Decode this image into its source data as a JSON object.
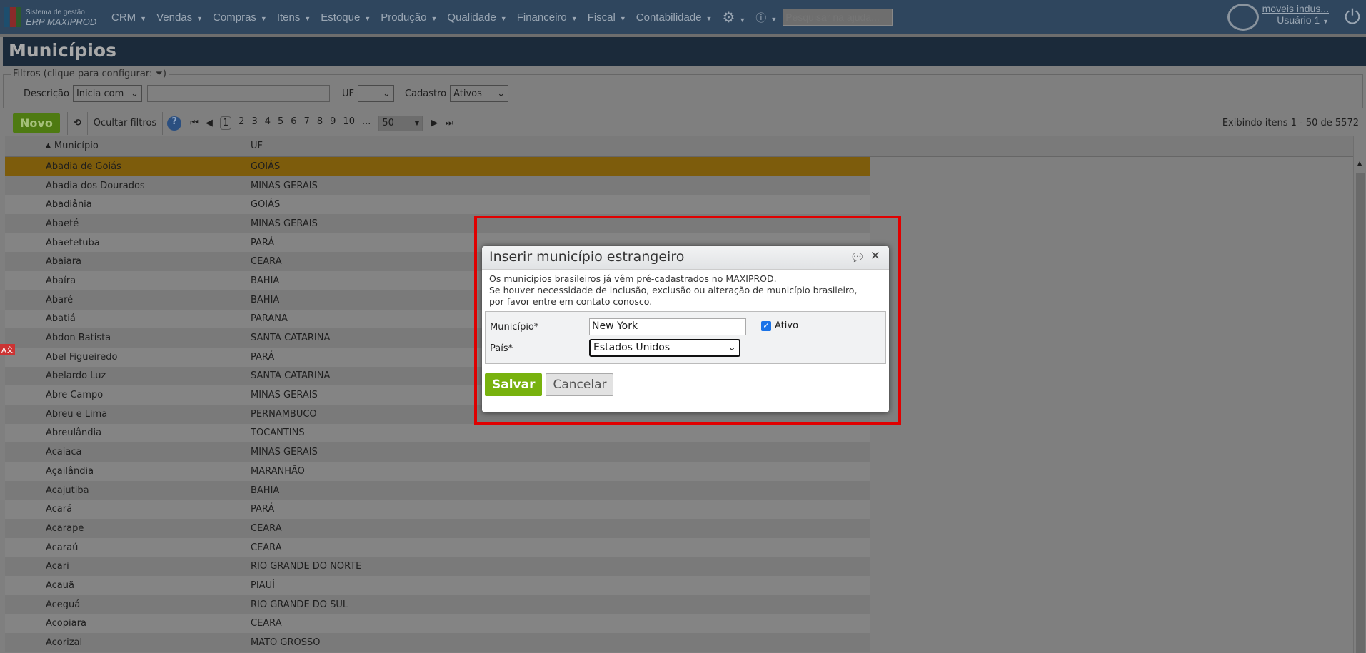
{
  "topbar": {
    "logo_line1": "Sistema de gestão",
    "logo_line2": "ERP MAXIPROD",
    "nav": [
      "CRM",
      "Vendas",
      "Compras",
      "Itens",
      "Estoque",
      "Produção",
      "Qualidade",
      "Financeiro",
      "Fiscal",
      "Contabilidade"
    ],
    "search_placeholder": "Pesquisar na ajuda...",
    "company": "moveis indus...",
    "user": "Usuário 1"
  },
  "page": {
    "title": "Municípios"
  },
  "filters": {
    "title": "Filtros (clique para configurar:",
    "descricao_label": "Descrição",
    "descricao_mode": "Inicia com",
    "uf_label": "UF",
    "uf_value": "",
    "cadastro_label": "Cadastro",
    "cadastro_value": "Ativos"
  },
  "toolbar": {
    "novo": "Novo",
    "ocultar": "Ocultar filtros",
    "pages": [
      "1",
      "2",
      "3",
      "4",
      "5",
      "6",
      "7",
      "8",
      "9",
      "10",
      "..."
    ],
    "per_page": "50",
    "exibindo": "Exibindo itens 1 - 50 de 5572"
  },
  "table": {
    "headers": [
      "Município",
      "UF"
    ],
    "rows": [
      [
        "Abadia de Goiás",
        "GOIÁS"
      ],
      [
        "Abadia dos Dourados",
        "MINAS GERAIS"
      ],
      [
        "Abadiânia",
        "GOIÁS"
      ],
      [
        "Abaeté",
        "MINAS GERAIS"
      ],
      [
        "Abaetetuba",
        "PARÁ"
      ],
      [
        "Abaiara",
        "CEARA"
      ],
      [
        "Abaíra",
        "BAHIA"
      ],
      [
        "Abaré",
        "BAHIA"
      ],
      [
        "Abatiá",
        "PARANA"
      ],
      [
        "Abdon Batista",
        "SANTA CATARINA"
      ],
      [
        "Abel Figueiredo",
        "PARÁ"
      ],
      [
        "Abelardo Luz",
        "SANTA CATARINA"
      ],
      [
        "Abre Campo",
        "MINAS GERAIS"
      ],
      [
        "Abreu e Lima",
        "PERNAMBUCO"
      ],
      [
        "Abreulândia",
        "TOCANTINS"
      ],
      [
        "Acaiaca",
        "MINAS GERAIS"
      ],
      [
        "Açailândia",
        "MARANHÃO"
      ],
      [
        "Acajutiba",
        "BAHIA"
      ],
      [
        "Acará",
        "PARÁ"
      ],
      [
        "Acarape",
        "CEARA"
      ],
      [
        "Acaraú",
        "CEARA"
      ],
      [
        "Acari",
        "RIO GRANDE DO NORTE"
      ],
      [
        "Acauã",
        "PIAUÍ"
      ],
      [
        "Aceguá",
        "RIO GRANDE DO SUL"
      ],
      [
        "Acopiara",
        "CEARA"
      ],
      [
        "Acorizal",
        "MATO GROSSO"
      ]
    ]
  },
  "dialog": {
    "title": "Inserir município estrangeiro",
    "msg": [
      "Os municípios brasileiros já vêm pré-cadastrados no MAXIPROD.",
      "Se houver necessidade de inclusão, exclusão ou alteração de município brasileiro,",
      "por favor entre em contato conosco."
    ],
    "municipio_label": "Município*",
    "municipio_value": "New York",
    "pais_label": "País*",
    "pais_value": "Estados Unidos",
    "ativo_label": "Ativo",
    "ativo_checked": true,
    "salvar": "Salvar",
    "cancelar": "Cancelar"
  }
}
